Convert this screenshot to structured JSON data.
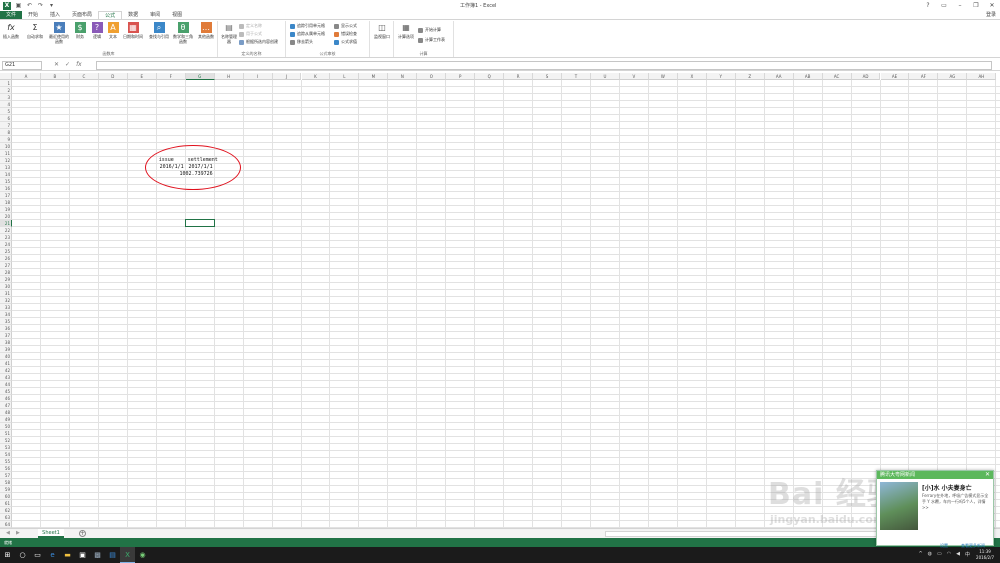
{
  "window": {
    "title": "工作簿1 - Excel",
    "login": "登录"
  },
  "tabs": [
    {
      "label": "文件",
      "type": "file"
    },
    {
      "label": "开始"
    },
    {
      "label": "插入"
    },
    {
      "label": "页面布局"
    },
    {
      "label": "公式",
      "active": true
    },
    {
      "label": "数据"
    },
    {
      "label": "审阅"
    },
    {
      "label": "视图"
    }
  ],
  "ribbon": {
    "library": {
      "insert_fn": "插入函数",
      "autosum": "自动求和",
      "recent": "最近使用的函数",
      "finance": "财务",
      "logical": "逻辑",
      "text": "文本",
      "datetime": "日期和时间",
      "lookup": "查找与引用",
      "math": "数学和三角函数",
      "more": "其他函数",
      "group": "函数库"
    },
    "names": {
      "manager": "名称管理器",
      "define": "定义名称",
      "use": "用于公式",
      "create": "根据所选内容创建",
      "group": "定义的名称"
    },
    "audit": {
      "trace_prec": "追踪引用单元格",
      "trace_dep": "追踪从属单元格",
      "remove": "移去箭头",
      "show": "显示公式",
      "error": "错误检查",
      "evaluate": "公式求值",
      "watch": "监视窗口",
      "group": "公式审核"
    },
    "calc": {
      "options": "计算选项",
      "now": "开始计算",
      "sheet": "计算工作表",
      "group": "计算"
    }
  },
  "formula_bar": {
    "name_box": "G21",
    "fx": "fx",
    "value": ""
  },
  "grid": {
    "columns": [
      "A",
      "B",
      "C",
      "D",
      "E",
      "F",
      "G",
      "H",
      "I",
      "J",
      "K",
      "L",
      "M",
      "N",
      "O",
      "P",
      "Q",
      "R",
      "S",
      "T",
      "U",
      "V",
      "W",
      "X",
      "Y",
      "Z",
      "AA",
      "AB",
      "AC",
      "AD",
      "AE",
      "AF",
      "AG",
      "AH"
    ],
    "selected_column": "G",
    "selected_row": 21,
    "row_count": 64,
    "cells": {
      "F12": "issue",
      "G12": "settlement",
      "F13": "2016/1/1",
      "G13": "2017/1/1",
      "G14": "1002.739726"
    }
  },
  "sheets": {
    "active": "Sheet1"
  },
  "status": {
    "ready": "就绪"
  },
  "taskbar": {
    "time": "11:39",
    "date": "2016/2/7"
  },
  "popup": {
    "header": "腾讯大粤网新闻",
    "title": "[小]水 小夫妻身亡",
    "body": "Ferrary在外地，呼吸广告模式显示全手 Y 水覆，车内一行吗5个人，详情>>",
    "link_left": "设置",
    "link_right": "查看更多新闻"
  },
  "watermark": {
    "text": "Bai 经验",
    "sub": "jingyan.baidu.com"
  },
  "colors": {
    "excel_green": "#217346",
    "circle_red": "#e0101c",
    "popup_green": "#5cb85c"
  }
}
